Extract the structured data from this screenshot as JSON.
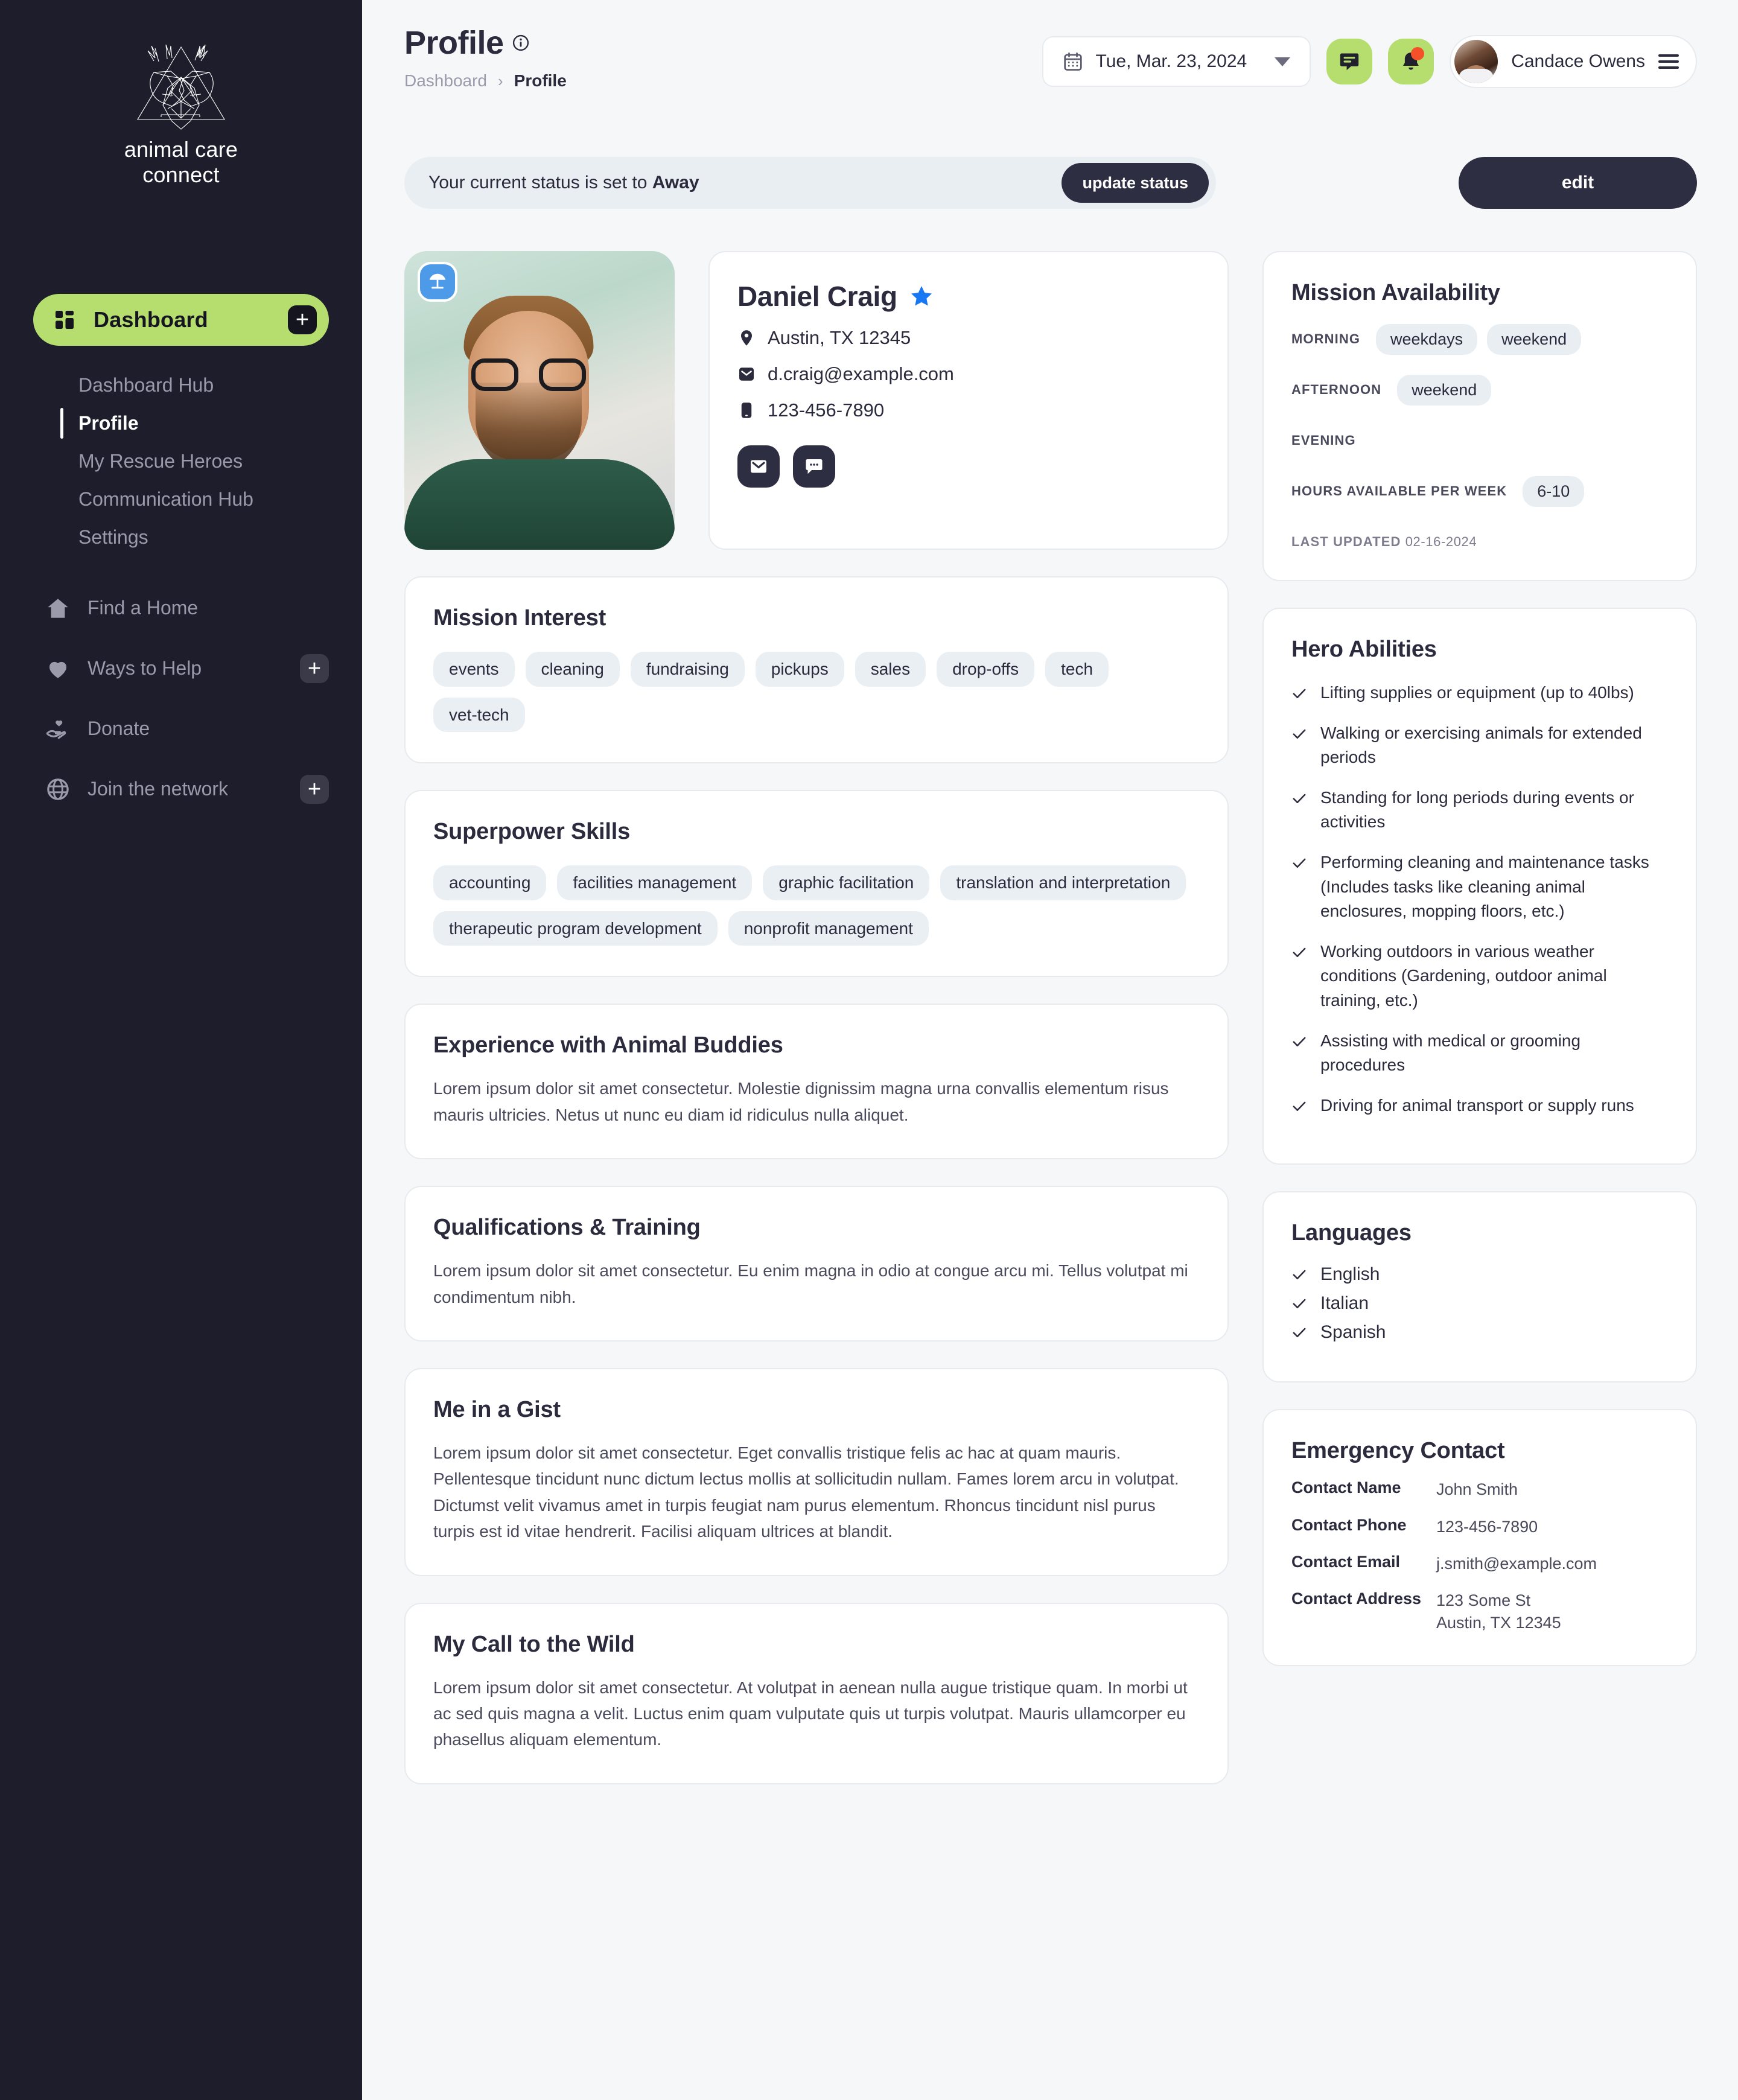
{
  "brand": {
    "name_line1": "animal care",
    "name_line2": "connect"
  },
  "sidebar": {
    "primary": {
      "label": "Dashboard",
      "add_label": "+"
    },
    "subitems": [
      {
        "label": "Dashboard Hub",
        "active": false
      },
      {
        "label": "Profile",
        "active": true
      },
      {
        "label": "My Rescue Heroes",
        "active": false
      },
      {
        "label": "Communication Hub",
        "active": false
      },
      {
        "label": "Settings",
        "active": false
      }
    ],
    "sections": [
      {
        "label": "Find a Home",
        "icon": "home-icon",
        "has_add": false
      },
      {
        "label": "Ways to Help",
        "icon": "heart-icon",
        "has_add": true
      },
      {
        "label": "Donate",
        "icon": "donate-hand-icon",
        "has_add": false
      },
      {
        "label": "Join the network",
        "icon": "globe-icon",
        "has_add": true
      }
    ]
  },
  "header": {
    "title": "Profile",
    "breadcrumb": {
      "parent": "Dashboard",
      "separator": "›",
      "current": "Profile"
    },
    "date_value": "Tue, Mar. 23, 2024",
    "user_name": "Candace Owens"
  },
  "status": {
    "text_prefix": "Your current status is set to ",
    "value": "Away",
    "update_label": "update status",
    "edit_label": "edit"
  },
  "profile": {
    "name": "Daniel Craig",
    "location": "Austin, TX 12345",
    "email": "d.craig@example.com",
    "phone": "123-456-7890",
    "status_icon": "beach-umbrella-icon",
    "verified_icon": "star-icon"
  },
  "mission_interest": {
    "title": "Mission Interest",
    "tags": [
      "events",
      "cleaning",
      "fundraising",
      "pickups",
      "sales",
      "drop-offs",
      "tech",
      "vet-tech"
    ]
  },
  "superpower_skills": {
    "title": "Superpower Skills",
    "tags": [
      "accounting",
      "facilities management",
      "graphic facilitation",
      "translation and interpretation",
      "therapeutic program development",
      "nonprofit management"
    ]
  },
  "experience": {
    "title": "Experience with Animal Buddies",
    "body": "Lorem ipsum dolor sit amet consectetur. Molestie dignissim magna urna convallis elementum risus mauris ultricies. Netus ut nunc eu diam id ridiculus nulla aliquet."
  },
  "qualifications": {
    "title": "Qualifications & Training",
    "body": "Lorem ipsum dolor sit amet consectetur. Eu enim magna in odio at congue arcu mi. Tellus volutpat mi condimentum nibh."
  },
  "gist": {
    "title": "Me in a Gist",
    "body": "Lorem ipsum dolor sit amet consectetur. Eget convallis tristique felis ac hac at quam mauris. Pellentesque tincidunt nunc dictum lectus mollis at sollicitudin nullam. Fames lorem arcu in volutpat. Dictumst velit vivamus amet in turpis feugiat nam purus elementum. Rhoncus tincidunt nisl purus turpis est id vitae hendrerit. Facilisi aliquam ultrices at blandit."
  },
  "call_to_wild": {
    "title": "My Call to the Wild",
    "body": "Lorem ipsum dolor sit amet consectetur. At volutpat in aenean nulla augue tristique quam. In morbi ut ac sed quis magna a velit. Luctus enim quam vulputate quis ut turpis volutpat. Mauris ullamcorper eu phasellus aliquam elementum."
  },
  "availability": {
    "title": "Mission Availability",
    "rows": [
      {
        "key": "MORNING",
        "values": [
          "weekdays",
          "weekend"
        ]
      },
      {
        "key": "AFTERNOON",
        "values": [
          "weekend"
        ]
      },
      {
        "key": "EVENING",
        "values": []
      }
    ],
    "hours_key": "HOURS AVAILABLE PER WEEK",
    "hours_value": "6-10",
    "last_updated_key": "LAST UPDATED",
    "last_updated_value": "02-16-2024"
  },
  "hero_abilities": {
    "title": "Hero Abilities",
    "items": [
      "Lifting supplies or equipment (up to 40lbs)",
      "Walking or exercising animals for extended periods",
      "Standing for long periods during events or activities",
      "Performing cleaning and maintenance tasks (Includes tasks like cleaning animal enclosures, mopping floors, etc.)",
      "Working outdoors in various weather conditions (Gardening, outdoor animal training, etc.)",
      "Assisting with medical or grooming procedures",
      "Driving for animal transport or supply runs"
    ]
  },
  "languages": {
    "title": "Languages",
    "items": [
      "English",
      "Italian",
      "Spanish"
    ]
  },
  "emergency_contact": {
    "title": "Emergency Contact",
    "rows": [
      {
        "key": "Contact Name",
        "value": "John Smith"
      },
      {
        "key": "Contact Phone",
        "value": "123-456-7890"
      },
      {
        "key": "Contact Email",
        "value": "j.smith@example.com"
      },
      {
        "key": "Contact Address",
        "value": "123 Some St\nAustin, TX 12345"
      }
    ]
  },
  "colors": {
    "sidebar_bg": "#1d1d2b",
    "accent_green": "#b5de6f",
    "dark": "#2e2e42",
    "page_bg": "#f6f7f8",
    "chip_bg": "#eaeff4",
    "status_blue": "#4d9ae8",
    "star_blue": "#1877f2",
    "badge_red": "#f4502a"
  }
}
